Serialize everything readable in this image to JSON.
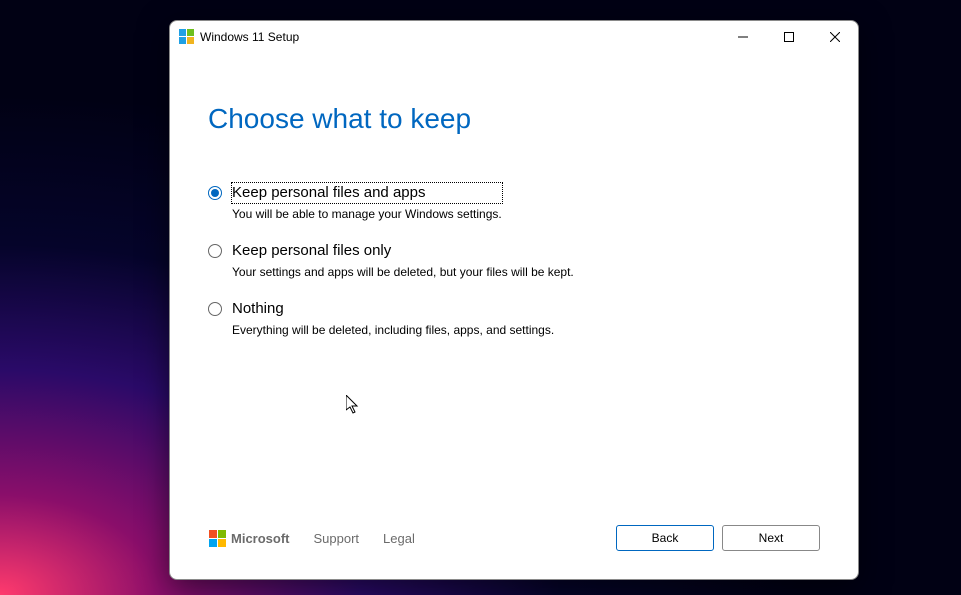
{
  "window": {
    "title": "Windows 11 Setup"
  },
  "page": {
    "heading": "Choose what to keep"
  },
  "options": [
    {
      "label": "Keep personal files and apps",
      "description": "You will be able to manage your Windows settings.",
      "selected": true
    },
    {
      "label": "Keep personal files only",
      "description": "Your settings and apps will be deleted, but your files will be kept.",
      "selected": false
    },
    {
      "label": "Nothing",
      "description": "Everything will be deleted, including files, apps, and settings.",
      "selected": false
    }
  ],
  "footer": {
    "brand": "Microsoft",
    "links": {
      "support": "Support",
      "legal": "Legal"
    },
    "buttons": {
      "back": "Back",
      "next": "Next"
    }
  }
}
